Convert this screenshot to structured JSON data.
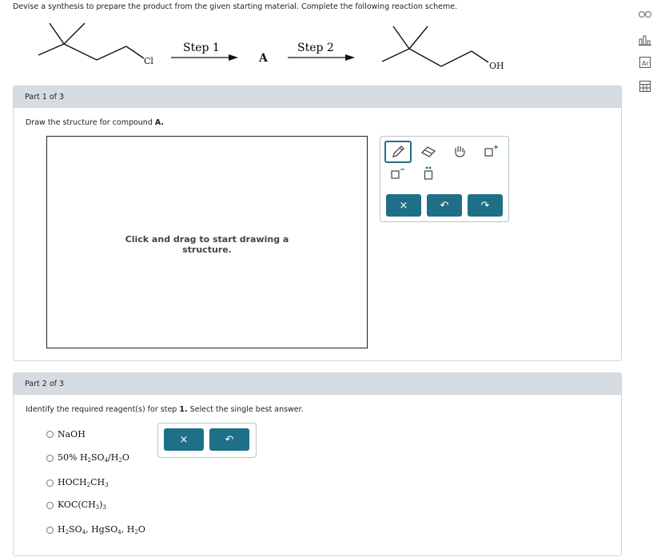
{
  "question": {
    "text": "Devise a synthesis to prepare the product from the given starting material. Complete the following reaction scheme."
  },
  "scheme": {
    "start_label": "Cl",
    "step1_label": "Step 1",
    "intermediate_label": "A",
    "step2_label": "Step 2",
    "product_label": "OH"
  },
  "part1": {
    "header": "Part 1 of 3",
    "instruction_prefix": "Draw the structure for compound ",
    "instruction_bold": "A.",
    "canvas_hint": "Click and drag to start drawing a structure."
  },
  "toolbox": {
    "tools": [
      "pencil-icon",
      "eraser-icon",
      "hand-icon",
      "add-positive-charge-icon",
      "add-negative-charge-icon",
      "lone-pair-icon"
    ],
    "buttons": {
      "clear": "×",
      "undo": "↶",
      "redo": "↷"
    }
  },
  "part2": {
    "header": "Part 2 of 3",
    "instruction_prefix": "Identify the required reagent(s) for step ",
    "instruction_bold": "1.",
    "instruction_suffix": " Select the single best answer.",
    "options": {
      "o1": "NaOH",
      "o2a": "50% H",
      "o2b": "2",
      "o2c": "SO",
      "o2d": "4",
      "o2e": "/H",
      "o2f": "2",
      "o2g": "O",
      "o3a": "HOCH",
      "o3b": "2",
      "o3c": "CH",
      "o3d": "3",
      "o4a": "KOC(CH",
      "o4b": "3",
      "o4c": ")",
      "o4d": "3",
      "o5a": "H",
      "o5b": "2",
      "o5c": "SO",
      "o5d": "4",
      "o5e": ", HgSO",
      "o5f": "4",
      "o5g": ", H",
      "o5h": "2",
      "o5i": "O"
    },
    "buttons": {
      "clear": "×",
      "undo": "↶"
    }
  },
  "sidebar": {
    "icons": [
      "glasses-icon",
      "periodic-table-icon",
      "reference-icon",
      "calculator-icon"
    ]
  }
}
